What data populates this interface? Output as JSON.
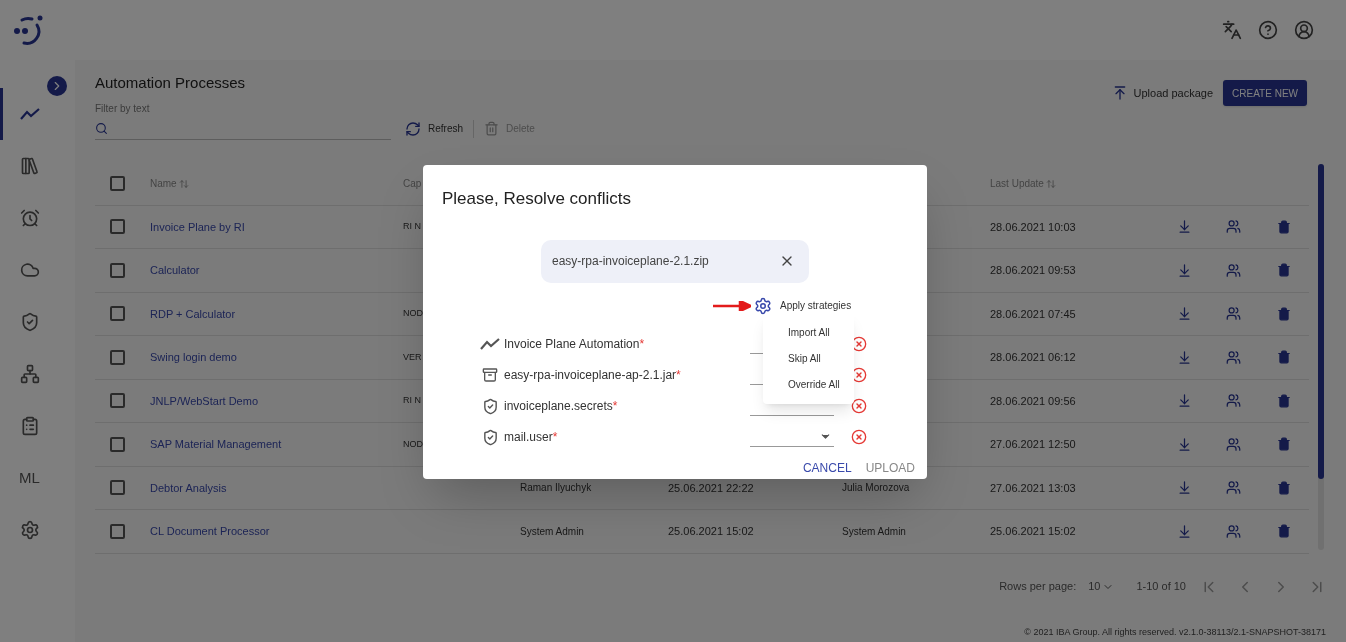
{
  "sidebar": {
    "items": [
      {
        "kind": "chart",
        "selected": true
      },
      {
        "kind": "library",
        "selected": false
      },
      {
        "kind": "alarm",
        "selected": false
      },
      {
        "kind": "cloud",
        "selected": false
      },
      {
        "kind": "shield",
        "selected": false
      },
      {
        "kind": "hub",
        "selected": false
      },
      {
        "kind": "clipboard",
        "selected": false
      },
      {
        "kind": "text",
        "label": "ML",
        "selected": false
      },
      {
        "kind": "gear",
        "selected": false
      }
    ]
  },
  "page": {
    "title": "Automation Processes",
    "filter_label": "Filter by text",
    "refresh": "Refresh",
    "delete": "Delete",
    "upload_package": "Upload package",
    "create_new": "CREATE NEW"
  },
  "table": {
    "select_all": {
      "checked": false
    },
    "columns": {
      "name": "Name",
      "column_2": "Cap",
      "last_update": "Last Update"
    },
    "rows": [
      {
        "checked": false,
        "name": "Invoice Plane by RI",
        "column_2": "RI N",
        "last_update": "28.06.2021 10:03"
      },
      {
        "checked": false,
        "name": "Calculator",
        "last_update": "28.06.2021 09:53"
      },
      {
        "checked": false,
        "name": "RDP + Calculator",
        "column_2": "NOD",
        "last_update": "28.06.2021 07:45"
      },
      {
        "checked": false,
        "name": "Swing login demo",
        "column_2": "VER",
        "last_update": "28.06.2021 06:12"
      },
      {
        "checked": false,
        "name": "JNLP/WebStart Demo",
        "column_2": "RI N",
        "last_update": "28.06.2021 09:56"
      },
      {
        "checked": false,
        "name": "SAP Material Management",
        "column_2": "NOD",
        "last_update": "27.06.2021 12:50"
      },
      {
        "checked": false,
        "name": "Debtor Analysis",
        "column_3": "Raman Ilyuchyk",
        "column_4": "25.06.2021 22:22",
        "column_5": "Julia Morozova",
        "last_update": "27.06.2021 13:03"
      },
      {
        "checked": false,
        "name": "CL Document Processor",
        "column_3": "System Admin",
        "column_4": "25.06.2021 15:02",
        "column_5": "System Admin",
        "last_update": "25.06.2021 15:02"
      }
    ]
  },
  "pagination": {
    "rows_per_page_label": "Rows per page:",
    "rows_per_page": "10",
    "range": "1-10 of 10"
  },
  "footer": "© 2021 IBA Group. All rights reserved. v2.1.0-38113/2.1-SNAPSHOT-38171",
  "dialog": {
    "title": "Please, Resolve conflicts",
    "file": "easy-rpa-invoiceplane-2.1.zip",
    "apply_strategies": "Apply strategies",
    "menu": [
      "Import All",
      "Skip All",
      "Override All"
    ],
    "conflicts": [
      {
        "kind": "process",
        "label": "Invoice Plane Automation",
        "required_mark": "*"
      },
      {
        "kind": "package",
        "label": "easy-rpa-invoiceplane-ap-2.1.jar",
        "required_mark": "*"
      },
      {
        "kind": "secret",
        "label": "invoiceplane.secrets",
        "required_mark": "*"
      },
      {
        "kind": "secret",
        "label": "mail.user",
        "required_mark": "*"
      }
    ],
    "cancel": "CANCEL",
    "upload": "UPLOAD"
  }
}
